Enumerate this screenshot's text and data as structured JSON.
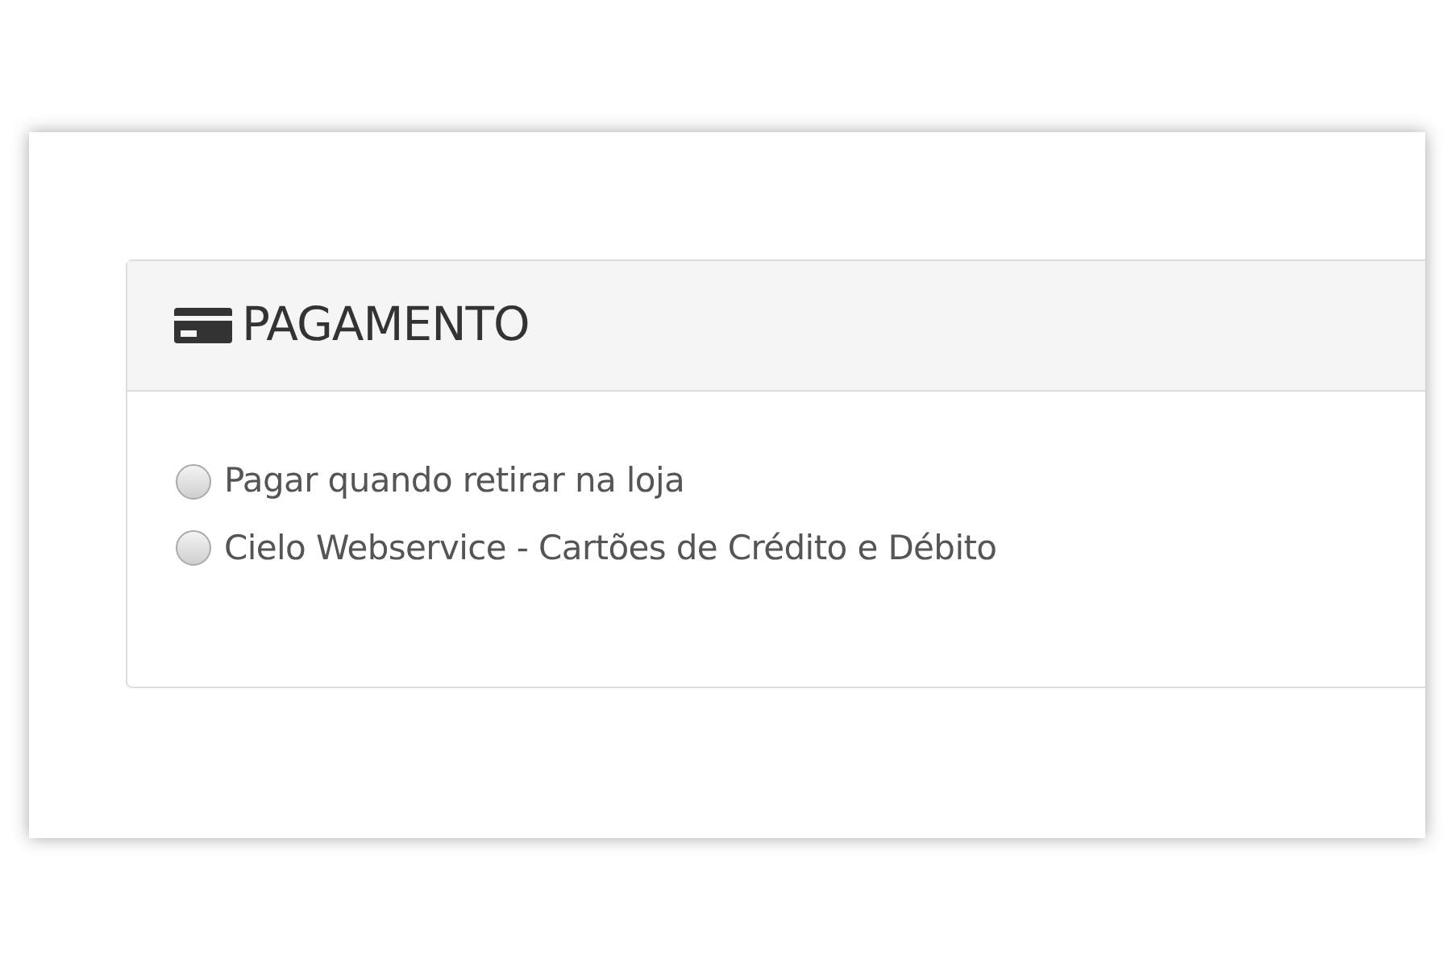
{
  "panel": {
    "title": "PAGAMENTO"
  },
  "options": [
    {
      "label": "Pagar quando retirar na loja",
      "selected": false
    },
    {
      "label": "Cielo Webservice - Cartões de Crédito e Débito",
      "selected": false
    }
  ]
}
